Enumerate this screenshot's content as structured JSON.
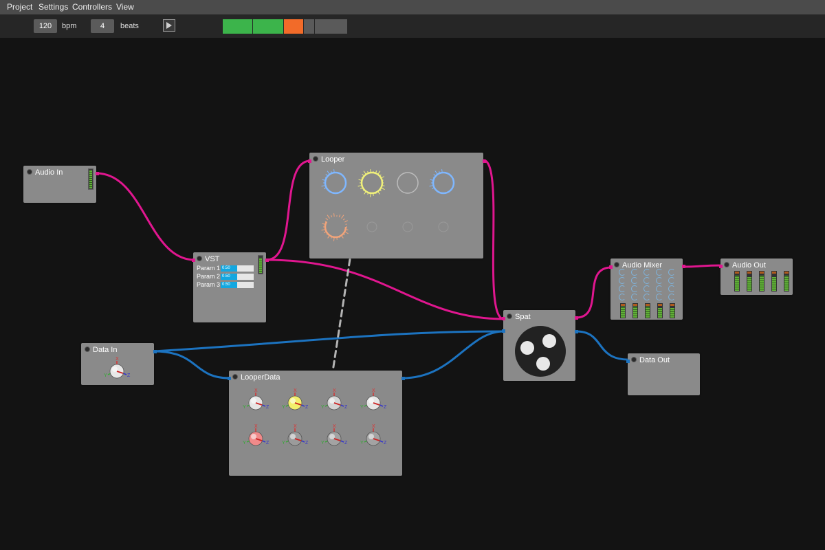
{
  "menu": [
    "Project",
    "Settings",
    "Controllers",
    "View"
  ],
  "transport": {
    "bpm_value": "120",
    "bpm_label": "bpm",
    "beats_value": "4",
    "beats_label": "beats",
    "beat_states": [
      "done",
      "done",
      "current",
      "pending"
    ],
    "colors": {
      "done": "#3cb44b",
      "current": "#f26b29",
      "pending": "#5a5a5a"
    }
  },
  "nodes": {
    "audio_in": {
      "title": "Audio In"
    },
    "looper": {
      "title": "Looper"
    },
    "vst": {
      "title": "VST",
      "params": [
        {
          "label": "Param 1",
          "value": "0.50",
          "level": 0.5
        },
        {
          "label": "Param 2",
          "value": "0.50",
          "level": 0.5
        },
        {
          "label": "Param 3",
          "value": "0.50",
          "level": 0.5
        }
      ]
    },
    "audio_mixer": {
      "title": "Audio Mixer"
    },
    "audio_out": {
      "title": "Audio Out"
    },
    "spat": {
      "title": "Spat"
    },
    "data_in": {
      "title": "Data In"
    },
    "looper_data": {
      "title": "LooperData"
    },
    "data_out": {
      "title": "Data Out"
    }
  },
  "looper_tracks": [
    {
      "color": "#7fb7ff",
      "state": "playing"
    },
    {
      "color": "#f0f07a",
      "state": "recording"
    },
    {
      "color": "#bcbcbc",
      "state": "empty"
    },
    {
      "color": "#7fb7ff",
      "state": "playing"
    },
    {
      "color": "#f2a47a",
      "state": "playing"
    },
    {
      "color": "#9a9a9a",
      "state": "empty"
    },
    {
      "color": "#9a9a9a",
      "state": "empty"
    },
    {
      "color": "#9a9a9a",
      "state": "empty"
    }
  ],
  "gizmo_axes": {
    "x": "X",
    "y": "Y",
    "z": "Z"
  },
  "colors": {
    "audio_wire": "#e0168f",
    "data_wire": "#1c73c0",
    "link_wire": "#b4b4b4"
  }
}
